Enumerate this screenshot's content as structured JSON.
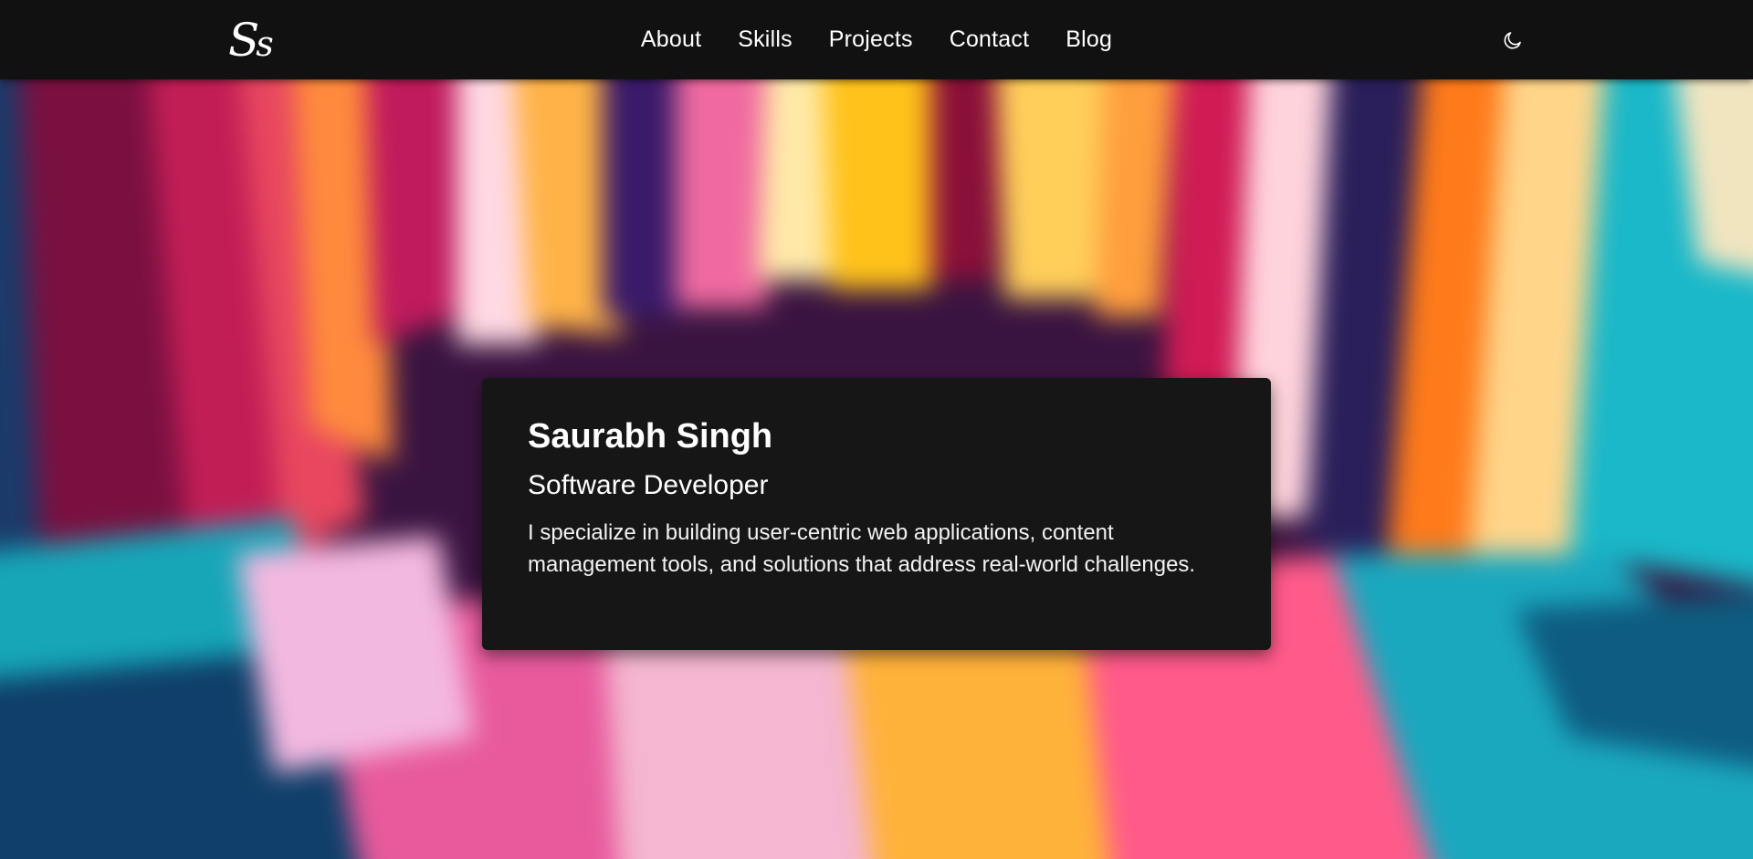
{
  "brand": {
    "logo_big": "S",
    "logo_small": "s"
  },
  "nav": {
    "items": [
      {
        "label": "About"
      },
      {
        "label": "Skills"
      },
      {
        "label": "Projects"
      },
      {
        "label": "Contact"
      },
      {
        "label": "Blog"
      }
    ],
    "theme_icon": "moon-icon"
  },
  "hero": {
    "name": "Saurabh Singh",
    "role": "Software Developer",
    "description": "I specialize in building user-centric web applications, content management tools, and solutions that address real-world challenges."
  },
  "colors": {
    "navbar_bg": "#111111",
    "card_bg": "#161616",
    "text": "#ffffff"
  }
}
